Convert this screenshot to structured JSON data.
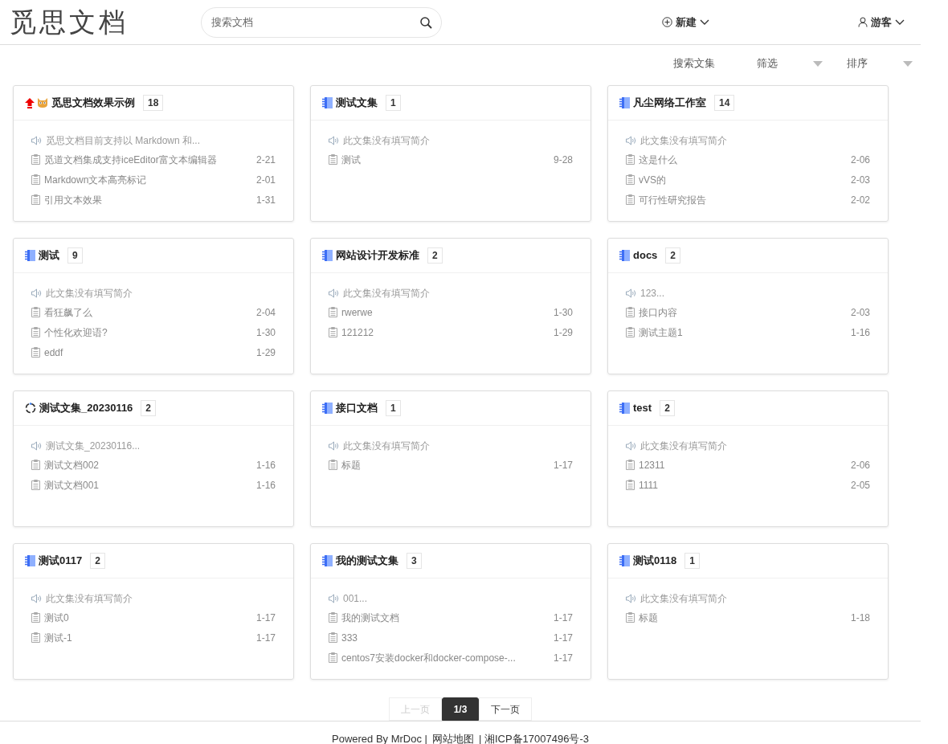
{
  "header": {
    "logo": "觅思文档",
    "search": {
      "placeholder": "搜索文档"
    },
    "new_menu": "新建",
    "user_menu": "游客"
  },
  "toolbar": {
    "search_collections": "搜索文集",
    "filter": "筛选",
    "sort": "排序"
  },
  "collections": [
    {
      "kind": "pinned",
      "title": "觅思文档效果示例",
      "count": "18",
      "intro": "觅思文档目前支持以 Markdown 和...",
      "docs": [
        {
          "title": "觅道文档集成支持iceEditor富文本编辑器",
          "date": "2-21"
        },
        {
          "title": "Markdown文本高亮标记",
          "date": "2-01"
        },
        {
          "title": "引用文本效果",
          "date": "1-31"
        }
      ]
    },
    {
      "kind": "notebook",
      "title": "测试文集",
      "count": "1",
      "intro": "此文集没有填写简介",
      "docs": [
        {
          "title": "测试",
          "date": "9-28"
        }
      ]
    },
    {
      "kind": "notebook",
      "title": "凡尘网络工作室",
      "count": "14",
      "intro": "此文集没有填写简介",
      "docs": [
        {
          "title": "这是什么",
          "date": "2-06"
        },
        {
          "title": "vVS的",
          "date": "2-03"
        },
        {
          "title": "可行性研究报告",
          "date": "2-02"
        }
      ]
    },
    {
      "kind": "notebook",
      "title": "测试",
      "count": "9",
      "intro": "此文集没有填写简介",
      "docs": [
        {
          "title": "看狂飙了么",
          "date": "2-04"
        },
        {
          "title": "个性化欢迎语?",
          "date": "1-30"
        },
        {
          "title": "eddf",
          "date": "1-29"
        }
      ]
    },
    {
      "kind": "notebook",
      "title": "网站设计开发标准",
      "count": "2",
      "intro": "此文集没有填写简介",
      "docs": [
        {
          "title": "rwerwe",
          "date": "1-30"
        },
        {
          "title": "121212",
          "date": "1-29"
        }
      ]
    },
    {
      "kind": "notebook",
      "title": "docs",
      "count": "2",
      "intro": "123...",
      "docs": [
        {
          "title": "接口内容",
          "date": "2-03"
        },
        {
          "title": "测试主题1",
          "date": "1-16"
        }
      ]
    },
    {
      "kind": "ring",
      "title": "测试文集_20230116",
      "count": "2",
      "intro": "测试文集_20230116...",
      "docs": [
        {
          "title": "测试文档002",
          "date": "1-16"
        },
        {
          "title": "测试文档001",
          "date": "1-16"
        }
      ]
    },
    {
      "kind": "notebook",
      "title": "接口文档",
      "count": "1",
      "intro": "此文集没有填写简介",
      "docs": [
        {
          "title": "标题",
          "date": "1-17"
        }
      ]
    },
    {
      "kind": "notebook",
      "title": "test",
      "count": "2",
      "intro": "此文集没有填写简介",
      "docs": [
        {
          "title": "12311",
          "date": "2-06"
        },
        {
          "title": "1111",
          "date": "2-05"
        }
      ]
    },
    {
      "kind": "notebook",
      "title": "测试0117",
      "count": "2",
      "intro": "此文集没有填写简介",
      "docs": [
        {
          "title": "测试0",
          "date": "1-17"
        },
        {
          "title": "测试-1",
          "date": "1-17"
        }
      ]
    },
    {
      "kind": "notebook",
      "title": "我的测试文集",
      "count": "3",
      "intro": "001...",
      "docs": [
        {
          "title": "我的测试文档",
          "date": "1-17"
        },
        {
          "title": "333",
          "date": "1-17"
        },
        {
          "title": "centos7安装docker和docker-compose-...",
          "date": "1-17"
        }
      ]
    },
    {
      "kind": "notebook",
      "title": "测试0118",
      "count": "1",
      "intro": "此文集没有填写简介",
      "docs": [
        {
          "title": "标题",
          "date": "1-18"
        }
      ]
    }
  ],
  "pagination": [
    {
      "label": "上一页",
      "disabled": true,
      "selected": false
    },
    {
      "label": "1/3",
      "disabled": false,
      "selected": true
    },
    {
      "label": "下一页",
      "disabled": false,
      "selected": false
    }
  ],
  "footer": {
    "powered": "Powered By MrDoc |",
    "sitemap": "网站地图",
    "icp": "| 湘ICP备17007496号-3"
  }
}
